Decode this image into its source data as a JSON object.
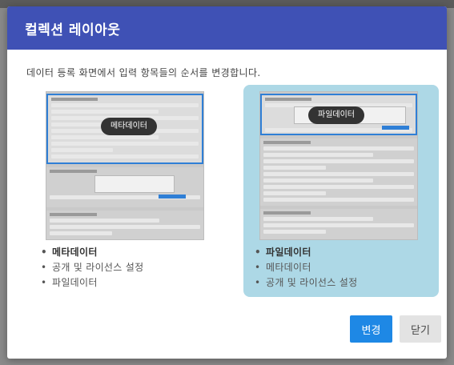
{
  "dialog": {
    "title": "컬렉션 레이아웃",
    "description": "데이터 등록 화면에서 입력 항목들의 순서를 변경합니다."
  },
  "options": [
    {
      "preview_label": "메타데이터",
      "selected": false,
      "items": [
        "메타데이터",
        "공개 및 라이선스 설정",
        "파일데이터"
      ]
    },
    {
      "preview_label": "파일데이터",
      "selected": true,
      "items": [
        "파일데이터",
        "메타데이터",
        "공개 및 라이선스 설정"
      ]
    }
  ],
  "buttons": {
    "confirm": "변경",
    "close": "닫기"
  },
  "colors": {
    "header": "#3f51b5",
    "selected_card": "#add8e6",
    "primary_button": "#1e88e5",
    "highlight_border": "#2f7fd6"
  }
}
